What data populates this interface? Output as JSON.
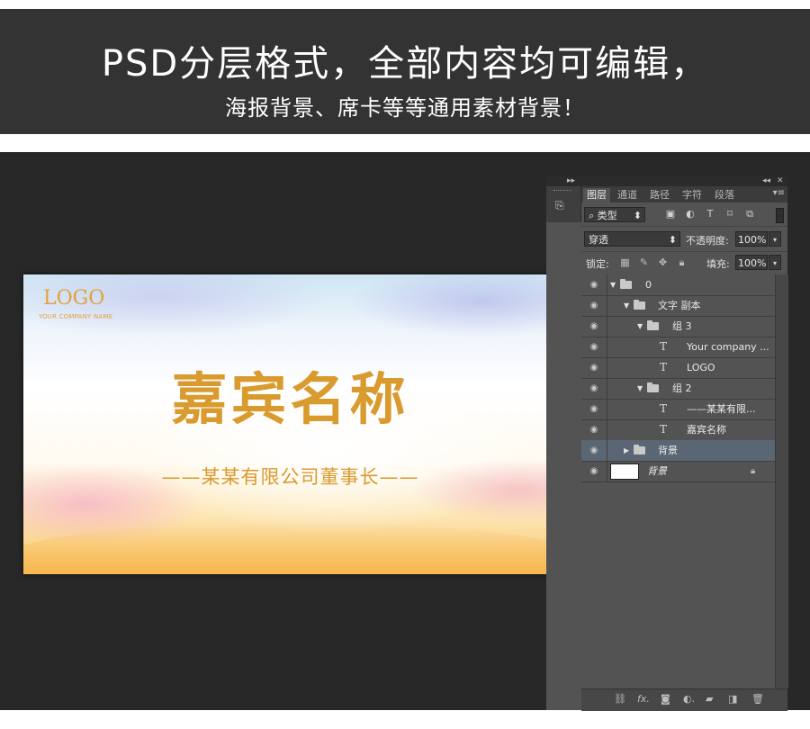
{
  "banner": {
    "headline": "PSD分层格式，全部内容均可编辑，",
    "subline": "海报背景、席卡等等通用素材背景！"
  },
  "card": {
    "logo": "LOGO",
    "company": "YOUR COMPANY NAME",
    "guest_name": "嘉宾名称",
    "guest_title": "——某某有限公司董事长——"
  },
  "panel": {
    "tabs": [
      "图层",
      "通道",
      "路径",
      "字符",
      "段落"
    ],
    "filter_kind": "类型",
    "blend_mode": "穿透",
    "opacity_label": "不透明度:",
    "opacity_value": "100%",
    "lock_label": "锁定:",
    "fill_label": "填充:",
    "fill_value": "100%",
    "layers": [
      {
        "name": "0",
        "type": "group",
        "expanded": true
      },
      {
        "name": "文字 副本",
        "type": "group",
        "expanded": true
      },
      {
        "name": "组 3",
        "type": "group",
        "expanded": true
      },
      {
        "name": "Your company ...",
        "type": "text"
      },
      {
        "name": "LOGO",
        "type": "text"
      },
      {
        "name": "组 2",
        "type": "group",
        "expanded": true
      },
      {
        "name": "——某某有限...",
        "type": "text"
      },
      {
        "name": "嘉宾名称",
        "type": "text"
      },
      {
        "name": "背景",
        "type": "group",
        "expanded": false,
        "selected": true
      },
      {
        "name": "背景",
        "type": "pixel",
        "locked": true
      }
    ]
  },
  "colors": {
    "banner_bg": "#333333",
    "workspace_bg": "#282828",
    "gold_text": "#d99a2e",
    "selected_layer": "#5a6673"
  }
}
